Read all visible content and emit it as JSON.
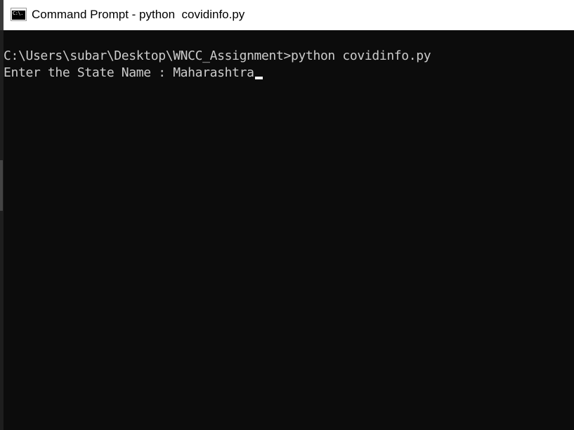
{
  "window": {
    "title": "Command Prompt - python  covidinfo.py",
    "icon": "cmd-icon",
    "icon_text": "C:\\."
  },
  "console": {
    "lines": [
      "C:\\Users\\subar\\Desktop\\WNCC_Assignment>python covidinfo.py",
      "Enter the State Name : Maharashtra"
    ],
    "background_color": "#0c0c0c",
    "text_color": "#cccccc"
  }
}
